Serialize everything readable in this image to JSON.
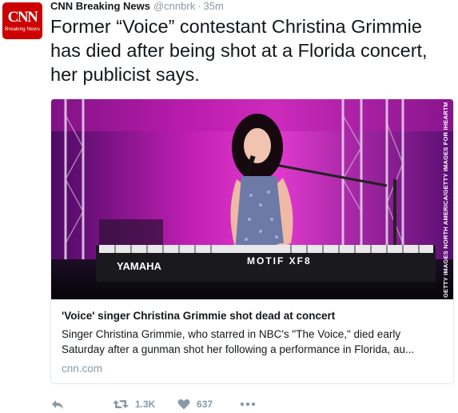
{
  "account": {
    "avatar_logo": "CNN",
    "avatar_sub": "Breaking News",
    "name": "CNN Breaking News",
    "handle": "@cnnbrk",
    "separator": "·",
    "time": "35m"
  },
  "tweet": {
    "text": "Former “Voice” contestant Christina Grimmie has died after being shot at a Florida concert, her publicist says."
  },
  "card": {
    "photo_credit": "GETTY IMAGES NORTH AMERICA/GETTY IMAGES FOR IHEARTMEDIA",
    "keyboard_brand": "YAMAHA",
    "keyboard_model": "MOTIF XF8",
    "title": "'Voice' singer Christina Grimmie shot dead at concert",
    "description": "Singer Christina Grimmie, who starred in NBC's \"The Voice,\" died early Saturday after a gunman shot her following a performance in Florida, au...",
    "domain": "cnn.com"
  },
  "actions": {
    "retweet_count": "1.3K",
    "like_count": "637"
  },
  "icons": {
    "reply": "reply-icon",
    "retweet": "retweet-icon",
    "like": "heart-icon",
    "more": "more-icon"
  },
  "colors": {
    "brand_red": "#cc0000",
    "text": "#14171a",
    "muted": "#8899a6",
    "border": "#e1e8ed"
  }
}
